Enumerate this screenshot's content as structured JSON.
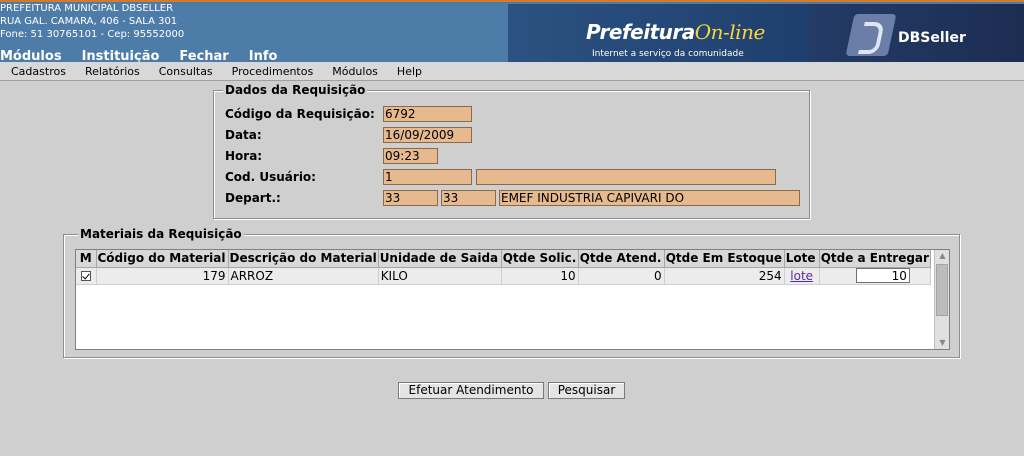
{
  "header": {
    "org_lines": [
      "PREFEITURA MUNICIPAL DBSELLER",
      "RUA GAL. CAMARA, 406 - SALA 301",
      "Fone: 51 30765101  -  Cep: 95552000"
    ],
    "main_menu": [
      "Módulos",
      "Instituição",
      "Fechar",
      "Info"
    ],
    "banner_title_main": "Prefeitura",
    "banner_title_accent": "On-line",
    "banner_subtitle": "Internet a serviço da comunidade",
    "brand_logo": "DBSeller"
  },
  "sub_menu": [
    "Cadastros",
    "Relatórios",
    "Consultas",
    "Procedimentos",
    "Módulos",
    "Help"
  ],
  "dados": {
    "title": "Dados da Requisição",
    "codigo_label": "Código da Requisição:",
    "codigo_value": "6792",
    "data_label": "Data:",
    "data_value": "16/09/2009",
    "hora_label": "Hora:",
    "hora_value": "09:23",
    "usuario_label": "Cod. Usuário:",
    "usuario_code": "1",
    "usuario_name": "",
    "depart_label": "Depart.:",
    "depart_code1": "33",
    "depart_code2": "33",
    "depart_name": "EMEF INDUSTRIA CAPIVARI DO"
  },
  "materiais": {
    "title": "Materiais da Requisição",
    "columns": [
      "M",
      "Código do Material",
      "Descrição do Material",
      "Unidade de Saida",
      "Qtde Solic.",
      "Qtde Atend.",
      "Qtde Em Estoque",
      "Lote",
      "Qtde a Entregar"
    ],
    "rows": [
      {
        "codigo": "179",
        "descricao": "ARROZ",
        "unidade": "KILO",
        "solic": "10",
        "atend": "0",
        "estoque": "254",
        "lote": "lote",
        "entregar": "10"
      }
    ]
  },
  "buttons": {
    "efetuar": "Efetuar Atendimento",
    "pesquisar": "Pesquisar"
  },
  "colors": {
    "header_bg": "#4d7ca9",
    "field_bg": "#e6b98e",
    "accent": "#ffd23a"
  }
}
